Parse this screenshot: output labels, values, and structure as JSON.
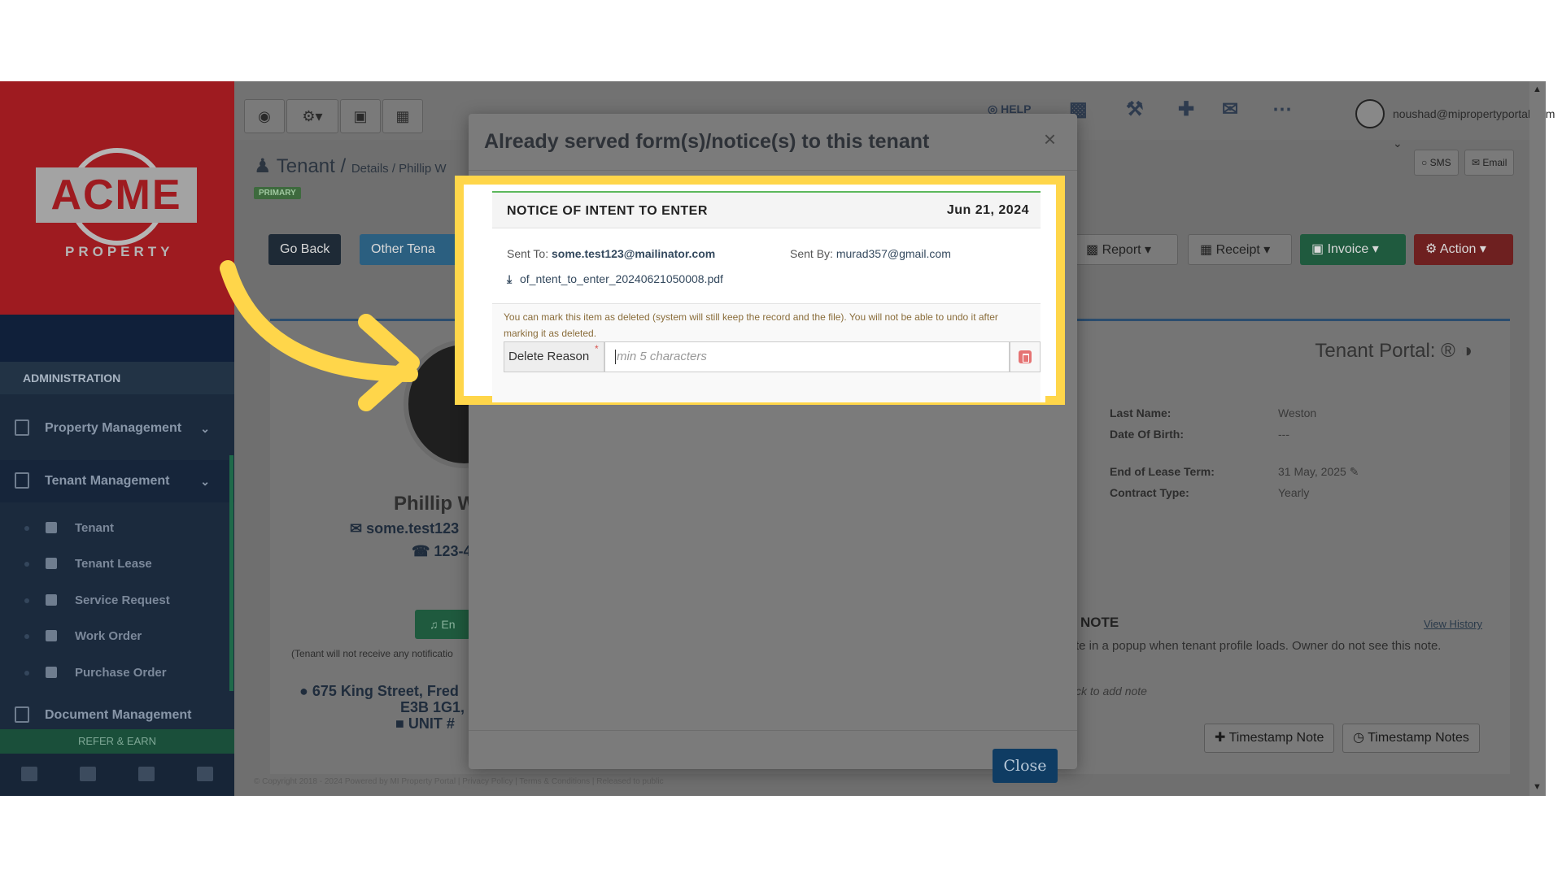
{
  "sidebar": {
    "logo_text": "ACME",
    "logo_sub": "PROPERTY",
    "section_label": "ADMINISTRATION",
    "items": [
      {
        "label": "Property Management"
      },
      {
        "label": "Tenant Management"
      }
    ],
    "sub_items": [
      {
        "label": "Tenant"
      },
      {
        "label": "Tenant Lease"
      },
      {
        "label": "Service Request"
      },
      {
        "label": "Work Order"
      },
      {
        "label": "Purchase Order"
      }
    ],
    "document_management": "Document Management",
    "refer": "REFER & EARN"
  },
  "topbar": {
    "help": "HELP",
    "user_email": "noushad@mipropertyportal.com"
  },
  "page": {
    "title": "Tenant",
    "crumb": "Details / Phillip W",
    "badge": "PRIMARY",
    "sms": "SMS",
    "email": "Email",
    "go_back": "Go Back",
    "other_tenants": "Other Tena",
    "report": "Report",
    "receipt": "Receipt",
    "invoice": "Invoice",
    "action": "Action",
    "tenant_portal": "Tenant Portal:",
    "last_name_label": "Last Name:",
    "last_name": "Weston",
    "dob_label": "Date Of Birth:",
    "dob": "---",
    "lease_end_label": "End of Lease Term:",
    "lease_end": "31 May, 2025",
    "contract_label": "Contract Type:",
    "contract": "Yearly",
    "profile_name": "Phillip W",
    "profile_email": "some.test123",
    "profile_phone": "123-4",
    "enroll": "En",
    "notif_note": "(Tenant will not receive any notificatio",
    "address_line1": "675 King Street, Fred",
    "address_line2": "E3B 1G1,",
    "unit": "UNIT #",
    "note_title": "NOTE",
    "view_history": "View History",
    "note_text": "te in a popup when tenant profile loads. Owner do not see this note.",
    "note_add": "ck to add note",
    "timestamp_note": "Timestamp Note",
    "timestamp_notes": "Timestamp Notes",
    "copyright": "© Copyright 2018 - 2024 Powered by MI Property Portal | Privacy Policy | Terms & Conditions | Released to public"
  },
  "modal": {
    "title": "Already served form(s)/notice(s) to this tenant",
    "close_label": "Close",
    "notice": {
      "title": "NOTICE OF INTENT TO ENTER",
      "date": "Jun 21, 2024",
      "sent_to_label": "Sent To:",
      "sent_to": "some.test123@mailinator.com",
      "sent_by_label": "Sent By:",
      "sent_by": "murad357@gmail.com",
      "file": "of_ntent_to_enter_20240621050008.pdf",
      "warning": "You can mark this item as deleted (system will still keep the record and the file). You will not be able to undo it after marking it as deleted.",
      "delete_reason_label": "Delete Reason",
      "delete_reason_placeholder": "min 5 characters"
    }
  },
  "colors": {
    "highlight": "#ffd64a",
    "close_button": "#0f3c63",
    "sidebar": "#1b2a3d",
    "logo_bg": "#9e1b20"
  }
}
